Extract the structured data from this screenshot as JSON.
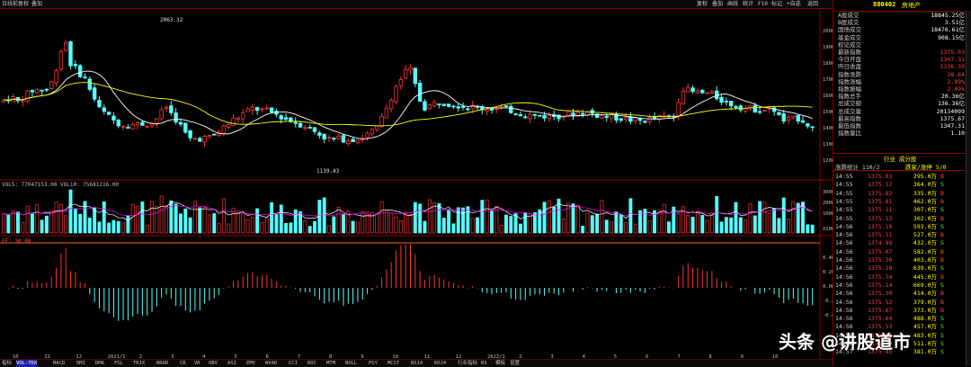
{
  "topbar": {
    "left_items": [
      "日线",
      "前复权",
      "叠加"
    ],
    "right_items": [
      "复权",
      "叠加",
      "画线",
      "统计",
      "F10",
      "标记",
      "+自选",
      "返回"
    ]
  },
  "price_axis": [
    "2000",
    "1900",
    "1800",
    "1700",
    "1600",
    "1500",
    "1400",
    "1300",
    "1200"
  ],
  "high_label": "2063.32",
  "low_label": "1139.43",
  "volume_legend": "VOL5: 77047153.00  VOL10: 75681216.00",
  "volume_axis": [
    "30000",
    "20000",
    "10000",
    "X10000"
  ],
  "indicator_legend": "FF: 30.00",
  "indicator_axis": [
    "0.40",
    "0.20",
    "0.00",
    "-0.20",
    "-0.40"
  ],
  "date_ticks": [
    "10",
    "11",
    "12",
    "2021/1",
    "2",
    "3",
    "4",
    "5",
    "6",
    "7",
    "8",
    "9",
    "10",
    "11",
    "12",
    "2022/1",
    "2",
    "3",
    "4",
    "5",
    "6",
    "7",
    "8",
    "9",
    "10"
  ],
  "bottom_tabs": [
    "指标",
    "VOL-TDX",
    "MACD",
    "DMI",
    "DMA",
    "FSL",
    "TRIX",
    "BRAR",
    "CR",
    "VR",
    "OBV",
    "ASI",
    "EMV",
    "WVAD",
    "CCI",
    "ROC",
    "MTM",
    "BOLL",
    "PSY",
    "MCST",
    "RSI4",
    "KDJ4",
    "行业指标",
    "RS",
    "模板",
    "设置"
  ],
  "quote_panel": {
    "code": "880402",
    "name": "房地产",
    "fields": [
      {
        "k": "A股成交",
        "v": "18845.25亿"
      },
      {
        "k": "B股成交",
        "v": "3.51亿"
      },
      {
        "k": "国债成交",
        "v": "18476.61亿"
      },
      {
        "k": "基金成交",
        "v": "908.15亿"
      },
      {
        "k": "权证成交",
        "v": ""
      },
      {
        "k": "最新指数",
        "v": "1375.03"
      },
      {
        "k": "今日开盘",
        "v": "1347.31"
      },
      {
        "k": "昨日收盘",
        "v": "1336.39"
      },
      {
        "k": "指数涨跌",
        "v": "38.64"
      },
      {
        "k": "指数涨幅",
        "v": "2.89%"
      },
      {
        "k": "指数振幅",
        "v": "2.49%"
      },
      {
        "k": "指数总手",
        "v": "20.36亿"
      },
      {
        "k": "总成交额",
        "v": "136.36亿"
      },
      {
        "k": "总成交量",
        "v": "20134099"
      },
      {
        "k": "最高指数",
        "v": "1375.67"
      },
      {
        "k": "最低指数",
        "v": "1347.31"
      },
      {
        "k": "指数量比",
        "v": "1.10"
      }
    ],
    "section_header": "行业 成分股",
    "updown_label": "涨跌统计 110/2",
    "ratio_label": "跌家/涨停 5/0",
    "ticks": [
      {
        "time": "14:55",
        "price": "1375.03",
        "vol": "295.0万",
        "flag": "B"
      },
      {
        "time": "14:55",
        "price": "1375.12",
        "vol": "364.0万",
        "flag": "S"
      },
      {
        "time": "14:55",
        "price": "1375.82",
        "vol": "335.0万",
        "flag": "B"
      },
      {
        "time": "14:55",
        "price": "1375.81",
        "vol": "462.0万",
        "flag": "B"
      },
      {
        "time": "14:55",
        "price": "1375.11",
        "vol": "307.0万",
        "flag": "S"
      },
      {
        "time": "14:55",
        "price": "1375.13",
        "vol": "302.0万",
        "flag": "B"
      },
      {
        "time": "14:56",
        "price": "1375.10",
        "vol": "593.0万",
        "flag": "S"
      },
      {
        "time": "14:56",
        "price": "1375.11",
        "vol": "527.0万",
        "flag": "B"
      },
      {
        "time": "14:56",
        "price": "1374.99",
        "vol": "432.0万",
        "flag": "S"
      },
      {
        "time": "14:56",
        "price": "1375.07",
        "vol": "582.0万",
        "flag": "B"
      },
      {
        "time": "14:56",
        "price": "1375.30",
        "vol": "403.0万",
        "flag": "B"
      },
      {
        "time": "14:56",
        "price": "1375.28",
        "vol": "639.0万",
        "flag": "S"
      },
      {
        "time": "14:56",
        "price": "1375.34",
        "vol": "445.0万",
        "flag": "B"
      },
      {
        "time": "14:56",
        "price": "1375.14",
        "vol": "669.0万",
        "flag": "S"
      },
      {
        "time": "14:56",
        "price": "1375.30",
        "vol": "414.0万",
        "flag": "B"
      },
      {
        "time": "14:56",
        "price": "1375.52",
        "vol": "379.0万",
        "flag": "B"
      },
      {
        "time": "14:56",
        "price": "1375.67",
        "vol": "373.0万",
        "flag": "B"
      },
      {
        "time": "14:56",
        "price": "1375.64",
        "vol": "488.0万",
        "flag": "S"
      },
      {
        "time": "14:56",
        "price": "1375.53",
        "vol": "457.0万",
        "flag": "S"
      },
      {
        "time": "14:56",
        "price": "1375.51",
        "vol": "483.0万",
        "flag": "S"
      },
      {
        "time": "14:57",
        "price": "1375.49",
        "vol": "511.0万",
        "flag": "S"
      },
      {
        "time": "14:57",
        "price": "1375.45",
        "vol": "381.0万",
        "flag": "S"
      }
    ]
  },
  "watermark": "头条 @讲股道市",
  "colors": {
    "up": "#ff3232",
    "down": "#54ffff",
    "ma1": "#ffffff",
    "ma2": "#ffff00",
    "grid": "#8a0000"
  }
}
